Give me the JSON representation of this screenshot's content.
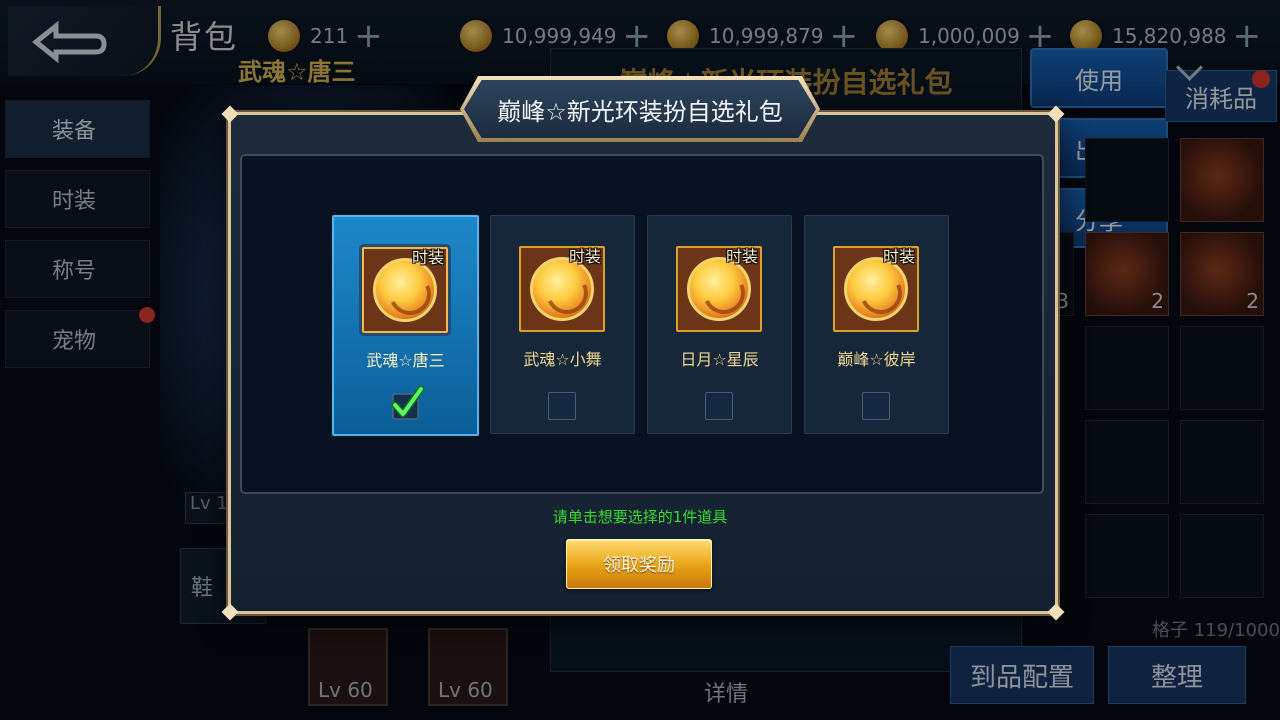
{
  "header": {
    "title": "背包",
    "character_name": "武魂☆唐三",
    "currencies": [
      {
        "value": "211",
        "icon": "coin-icon"
      },
      {
        "value": "10,999,949",
        "icon": "coin-icon"
      },
      {
        "value": "10,999,879",
        "icon": "coin-icon"
      },
      {
        "value": "1,000,009",
        "icon": "coin-icon"
      },
      {
        "value": "15,820,988",
        "icon": "coin-icon"
      }
    ],
    "plus_symbol": "+"
  },
  "sidebar": {
    "tabs": [
      "装备",
      "时装",
      "称号",
      "宠物"
    ]
  },
  "character": {
    "level": "Lv 1",
    "slot_label": "鞋"
  },
  "inventory_preview": {
    "items": [
      "Lv 60",
      "Lv 60"
    ]
  },
  "background_panel": {
    "title": "巅峰☆新光环装扮自选礼包",
    "detail_label": "详情"
  },
  "actions": {
    "use": "使用",
    "sell": "出售",
    "share": "分享",
    "consumables": "消耗品",
    "counts": [
      "3",
      "2",
      "2"
    ],
    "capacity": "格子 119/1000",
    "equip": "到品配置",
    "sort": "整理"
  },
  "modal": {
    "title": "巅峰☆新光环装扮自选礼包",
    "tag": "时装",
    "options": [
      {
        "name": "武魂☆唐三",
        "selected": true
      },
      {
        "name": "武魂☆小舞",
        "selected": false
      },
      {
        "name": "日月☆星辰",
        "selected": false
      },
      {
        "name": "巅峰☆彼岸",
        "selected": false
      }
    ],
    "hint": "请单击想要选择的1件道具",
    "claim_button": "领取奖励"
  },
  "colors": {
    "gold": "#d9b54f",
    "selected_card": "#1e88c9",
    "hint_green": "#36dc30",
    "claim_button": "#e7a114"
  }
}
